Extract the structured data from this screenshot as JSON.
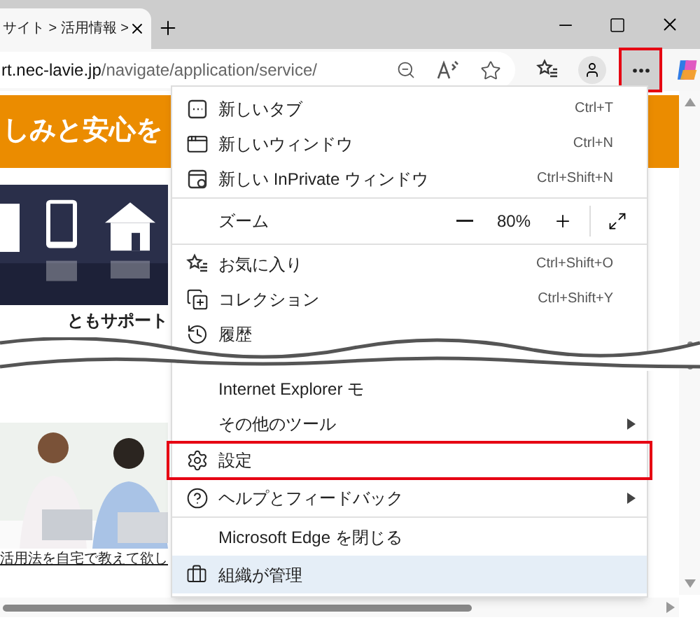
{
  "tab": {
    "title": "サイト > 活用情報 >"
  },
  "address_bar": {
    "domain": "rt.nec-lavie.jp",
    "path": "/navigate/application/service/"
  },
  "toolbar": {
    "more_highlighted": true
  },
  "page": {
    "banner": "しみと安心を",
    "heading": "ともサポート",
    "caption": "活用法を自宅で教えて欲し"
  },
  "menu": {
    "items": [
      {
        "kind": "item",
        "label": "新しいタブ",
        "shortcut": "Ctrl+T",
        "submenu": false,
        "highlighted": false
      },
      {
        "kind": "item",
        "label": "新しいウィンドウ",
        "shortcut": "Ctrl+N",
        "submenu": false,
        "highlighted": false
      },
      {
        "kind": "item",
        "label": "新しい InPrivate ウィンドウ",
        "shortcut": "Ctrl+Shift+N",
        "submenu": false,
        "highlighted": false
      },
      {
        "kind": "divider"
      },
      {
        "kind": "zoom",
        "label": "ズーム",
        "value": "80%"
      },
      {
        "kind": "divider"
      },
      {
        "kind": "item",
        "label": "お気に入り",
        "shortcut": "Ctrl+Shift+O",
        "submenu": false,
        "highlighted": false
      },
      {
        "kind": "item",
        "label": "コレクション",
        "shortcut": "Ctrl+Shift+Y",
        "submenu": false,
        "highlighted": false
      },
      {
        "kind": "item",
        "label": "履歴",
        "submenu": false,
        "highlighted": false
      },
      {
        "kind": "break"
      },
      {
        "kind": "item",
        "label": "Internet Explorer モ",
        "submenu": false,
        "highlighted": false
      },
      {
        "kind": "item",
        "label": "その他のツール",
        "submenu": true,
        "highlighted": false
      },
      {
        "kind": "item",
        "label": "設定",
        "submenu": false,
        "highlighted": true
      },
      {
        "kind": "item",
        "label": "ヘルプとフィードバック",
        "submenu": true,
        "highlighted": false
      },
      {
        "kind": "divider"
      },
      {
        "kind": "item",
        "label": "Microsoft Edge を閉じる",
        "submenu": false,
        "highlighted": false
      },
      {
        "kind": "managed",
        "label": "組織が管理"
      }
    ]
  }
}
